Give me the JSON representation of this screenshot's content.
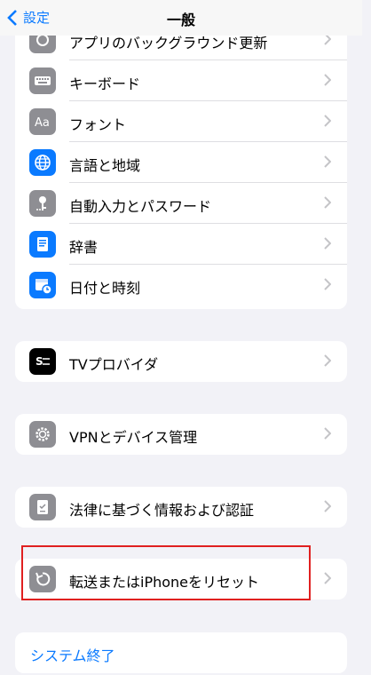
{
  "nav": {
    "back_label": "設定",
    "title": "一般"
  },
  "group1": {
    "items": [
      {
        "label": "アプリのバックグラウンド更新",
        "icon": "refresh-icon"
      },
      {
        "label": "キーボード",
        "icon": "keyboard-icon"
      },
      {
        "label": "フォント",
        "icon": "font-icon"
      },
      {
        "label": "言語と地域",
        "icon": "globe-icon"
      },
      {
        "label": "自動入力とパスワード",
        "icon": "key-icon"
      },
      {
        "label": "辞書",
        "icon": "dictionary-icon"
      },
      {
        "label": "日付と時刻",
        "icon": "calendar-clock-icon"
      }
    ]
  },
  "group2": {
    "items": [
      {
        "label": "TVプロバイダ",
        "icon": "tv-provider-icon"
      }
    ]
  },
  "group3": {
    "items": [
      {
        "label": "VPNとデバイス管理",
        "icon": "gear-icon"
      }
    ]
  },
  "group4": {
    "items": [
      {
        "label": "法律に基づく情報および認証",
        "icon": "legal-document-icon"
      }
    ]
  },
  "group5": {
    "items": [
      {
        "label": "転送またはiPhoneをリセット",
        "icon": "reset-icon"
      }
    ]
  },
  "shutdown": {
    "label": "システム終了"
  },
  "colors": {
    "accent": "#0a7aff",
    "highlight": "#e02020",
    "background": "#f2f2f7"
  }
}
